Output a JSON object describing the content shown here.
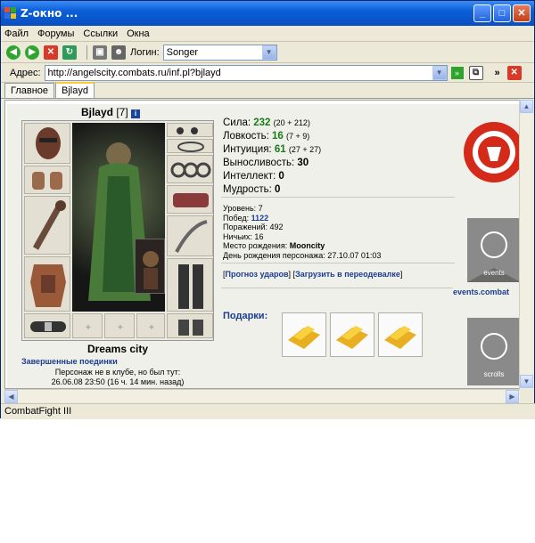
{
  "window": {
    "title": "Z-окно ..."
  },
  "menu": [
    "Файл",
    "Форумы",
    "Ссылки",
    "Окна"
  ],
  "toolbar": {
    "login_label": "Логин:",
    "login_value": "Songer"
  },
  "address": {
    "label": "Адрес:",
    "url": "http://angelscity.combats.ru/inf.pl?bjlayd"
  },
  "tabs": [
    "Главное",
    "Bjlayd"
  ],
  "character": {
    "name": "Bjlayd",
    "level": "[7]",
    "info_icon": "i",
    "city": "Dreams city",
    "battles_link": "Завершенные поединки",
    "club_line1": "Персонаж не в клубе, но был тут:",
    "club_line2": "26.06.08 23:50 (16 ч. 14 мин. назад)"
  },
  "stats": [
    {
      "label": "Сила:",
      "value": "232",
      "bonus": "(20 + 212)",
      "green": true
    },
    {
      "label": "Ловкость:",
      "value": "16",
      "bonus": "(7 + 9)",
      "green": true
    },
    {
      "label": "Интуиция:",
      "value": "61",
      "bonus": "(27 + 27)",
      "green": true
    },
    {
      "label": "Выносливость:",
      "value": "30",
      "bonus": "",
      "green": false
    },
    {
      "label": "Интеллект:",
      "value": "0",
      "bonus": "",
      "green": false
    },
    {
      "label": "Мудрость:",
      "value": "0",
      "bonus": "",
      "green": false
    }
  ],
  "info": {
    "level": "Уровень: 7",
    "wins_label": "Побед:",
    "wins": "1122",
    "losses": "Поражений: 492",
    "draws": "Ничьих: 16",
    "birthplace_label": "Место рождения:",
    "birthplace": "Mooncity",
    "birthday": "День рождения персонажа: 27.10.07 01:03"
  },
  "links": {
    "forecast": "Прогноз ударов",
    "wardrobe": "Загрузить в переодевалке"
  },
  "gifts": {
    "title": "Подарки:",
    "count": 3
  },
  "emblems": {
    "events_label": "events",
    "events_link": "events.combat",
    "scrolls_label": "scrolls"
  },
  "status": "CombatFight III",
  "colors": {
    "accent_blue": "#1a3d8f",
    "stat_green": "#1a7a1a",
    "title_blue": "#0a5fd8"
  }
}
